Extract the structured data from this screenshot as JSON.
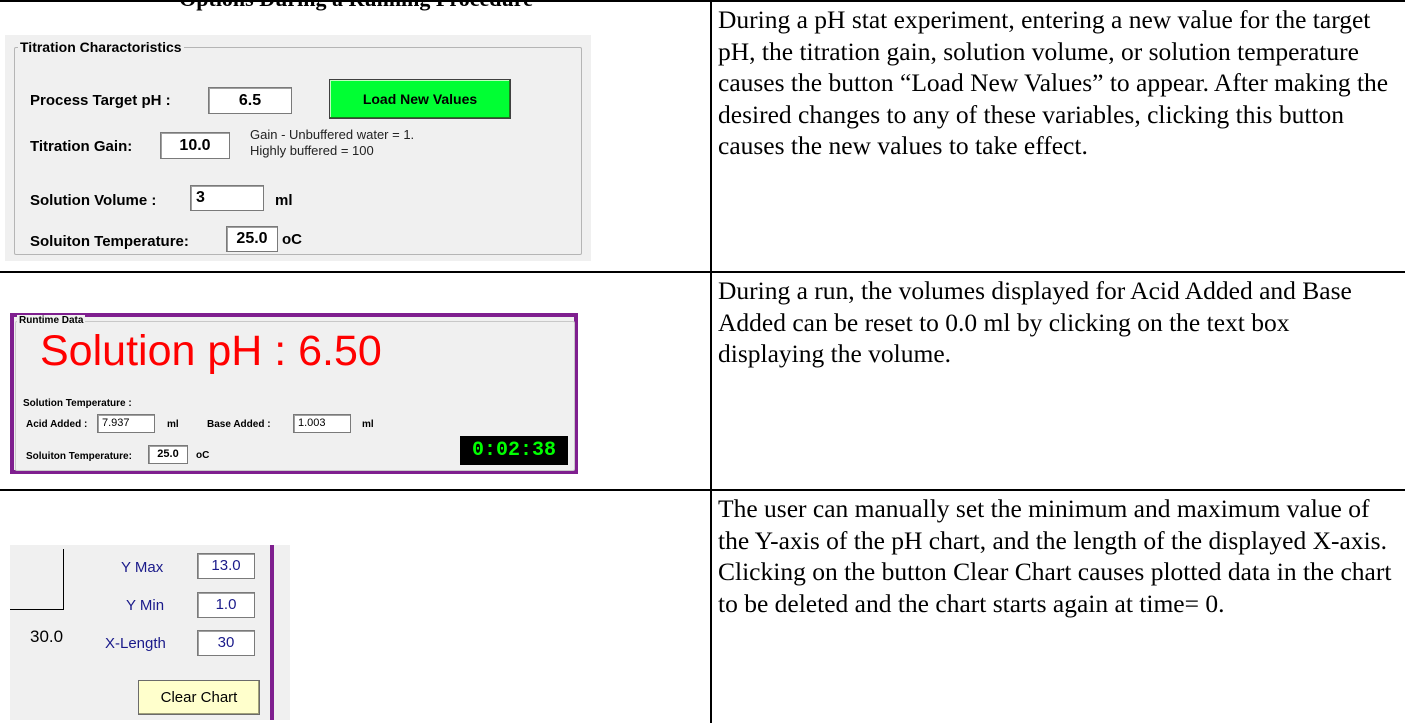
{
  "header": {
    "title": "Options During a Running Procedure"
  },
  "rows": [
    {
      "description": "During a pH stat experiment, entering a new value for the target pH, the titration gain, solution volume, or solution temperature causes the button “Load New Values” to appear.  After making the desired changes to any of these variables, clicking this button causes the new values to take effect."
    },
    {
      "description": "During a run, the volumes displayed for Acid Added and Base Added can be reset to 0.0 ml by clicking on the text box displaying the volume."
    },
    {
      "description": "The user can manually set the minimum and maximum value of the Y-axis of the pH chart, and the length of the displayed X-axis.\nClicking on the button Clear Chart causes plotted data in the chart to be deleted and the chart starts again at time= 0."
    }
  ],
  "titration": {
    "group_title": "Titration Charactoristics",
    "target_ph_label": "Process Target pH :",
    "target_ph_value": "6.5",
    "load_button": "Load New Values",
    "gain_label": "Titration Gain:",
    "gain_value": "10.0",
    "gain_hint_1": "Gain - Unbuffered water = 1.",
    "gain_hint_2": "Highly buffered = 100",
    "volume_label": "Solution Volume :",
    "volume_value": "3",
    "volume_unit": "ml",
    "temp_label": "Soluiton Temperature:",
    "temp_value": "25.0",
    "temp_unit": "oC"
  },
  "runtime": {
    "group_title": "Runtime Data",
    "ph_readout": "Solution pH : 6.50",
    "solution_temp_label": "Solution Temperature :",
    "acid_label": "Acid Added :",
    "acid_value": "7.937",
    "acid_unit": "ml",
    "base_label": "Base Added :",
    "base_value": "1.003",
    "base_unit": "ml",
    "temp_label": "Soluiton Temperature:",
    "temp_value": "25.0",
    "temp_unit": "oC",
    "timer": "0:02:38",
    "colors": {
      "ph_text": "#ff0000",
      "border": "#7f1f8f",
      "timer_text": "#00ff00"
    }
  },
  "chart_controls": {
    "axis_tick_label": "30.0",
    "ymax_label": "Y Max",
    "ymax_value": "13.0",
    "ymin_label": "Y Min",
    "ymin_value": "1.0",
    "xlength_label": "X-Length",
    "xlength_value": "30",
    "clear_button": "Clear Chart"
  }
}
